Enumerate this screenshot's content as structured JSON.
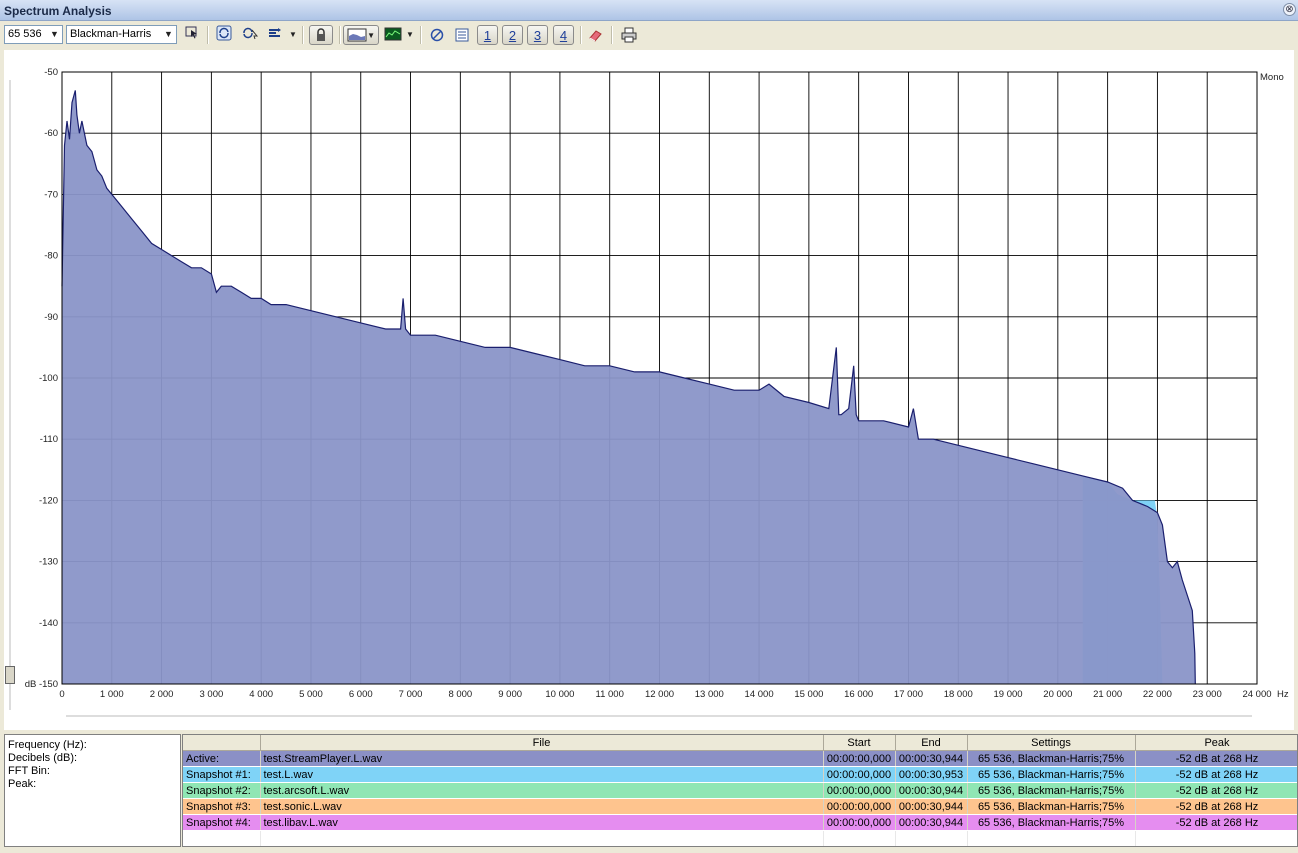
{
  "window": {
    "title": "Spectrum Analysis",
    "close_label": "⊗"
  },
  "toolbar": {
    "fft_size": "65 536",
    "window_function": "Blackman-Harris",
    "snapshot_buttons": [
      "1",
      "2",
      "3",
      "4"
    ]
  },
  "chart_data": {
    "type": "area",
    "channel_label": "Mono",
    "x_unit": "Hz",
    "y_unit": "dB",
    "xlim": [
      0,
      24000
    ],
    "ylim": [
      -150,
      -50
    ],
    "x_ticks": [
      0,
      1000,
      2000,
      3000,
      4000,
      5000,
      6000,
      7000,
      8000,
      9000,
      10000,
      11000,
      12000,
      13000,
      14000,
      15000,
      16000,
      17000,
      18000,
      19000,
      20000,
      21000,
      22000,
      23000,
      24000
    ],
    "x_tick_labels": [
      "0",
      "1 000",
      "2 000",
      "3 000",
      "4 000",
      "5 000",
      "6 000",
      "7 000",
      "8 000",
      "9 000",
      "10 000",
      "11 000",
      "12 000",
      "13 000",
      "14 000",
      "15 000",
      "16 000",
      "17 000",
      "18 000",
      "19 000",
      "20 000",
      "21 000",
      "22 000",
      "23 000",
      "24 000"
    ],
    "y_ticks": [
      -50,
      -60,
      -70,
      -80,
      -90,
      -100,
      -110,
      -120,
      -130,
      -140,
      -150
    ],
    "y_tick_labels": [
      "-50",
      "-60",
      "-70",
      "-80",
      "-90",
      "-100",
      "-110",
      "-120",
      "-130",
      "-140",
      "dB -150"
    ],
    "grid": true,
    "series": [
      {
        "name": "Active",
        "color": "#8a95c8",
        "stroke": "#1a1f6e",
        "x": [
          0,
          50,
          100,
          150,
          200,
          268,
          300,
          350,
          400,
          500,
          600,
          700,
          800,
          900,
          1000,
          1200,
          1400,
          1600,
          1800,
          2000,
          2200,
          2400,
          2600,
          2800,
          3000,
          3100,
          3200,
          3400,
          3600,
          3800,
          4000,
          4200,
          4500,
          5000,
          5500,
          6000,
          6500,
          6800,
          6850,
          6900,
          7000,
          7500,
          8000,
          8500,
          9000,
          9500,
          10000,
          10500,
          11000,
          11500,
          12000,
          12500,
          13000,
          13500,
          14000,
          14200,
          14500,
          15000,
          15400,
          15550,
          15600,
          15650,
          15800,
          15900,
          15950,
          16000,
          16500,
          17000,
          17100,
          17200,
          17500,
          18000,
          18500,
          19000,
          19500,
          20000,
          20500,
          21000,
          21300,
          21500,
          21800,
          22000,
          22100,
          22200,
          22300,
          22400,
          22500,
          22700,
          22750,
          22760
        ],
        "y": [
          -85,
          -62,
          -58,
          -61,
          -55,
          -53,
          -57,
          -60,
          -58,
          -62,
          -63,
          -66,
          -67,
          -69,
          -70,
          -72,
          -74,
          -76,
          -78,
          -79,
          -80,
          -81,
          -82,
          -82,
          -83,
          -86,
          -85,
          -85,
          -86,
          -87,
          -87,
          -88,
          -88,
          -89,
          -90,
          -91,
          -92,
          -92,
          -87,
          -92,
          -93,
          -93,
          -94,
          -95,
          -95,
          -96,
          -97,
          -98,
          -98,
          -99,
          -99,
          -100,
          -101,
          -102,
          -102,
          -101,
          -103,
          -104,
          -105,
          -95,
          -106,
          -106,
          -105,
          -98,
          -106,
          -107,
          -107,
          -108,
          -105,
          -110,
          -110,
          -111,
          -112,
          -113,
          -114,
          -115,
          -116,
          -117,
          -118,
          -120,
          -121,
          -122,
          -124,
          -130,
          -131,
          -130,
          -133,
          -138,
          -145,
          -150
        ]
      },
      {
        "name": "Snapshot #1",
        "color": "#78d0f5",
        "x": [
          20500,
          21000,
          21200,
          21500,
          21800,
          21950,
          22000,
          22050,
          22100
        ],
        "y": [
          -116,
          -117,
          -119,
          -120,
          -120,
          -120,
          -123,
          -135,
          -150
        ]
      }
    ]
  },
  "info_panel": {
    "lines": [
      "Frequency (Hz):",
      "Decibels (dB):",
      "FFT Bin:",
      "Peak:"
    ]
  },
  "snapshot_table": {
    "headers": [
      "",
      "File",
      "Start",
      "End",
      "Settings",
      "Peak"
    ],
    "rows": [
      {
        "label": "Active:",
        "file": "test.StreamPlayer.L.wav",
        "start": "00:00:00,000",
        "end": "00:00:30,944",
        "settings": "65 536, Blackman-Harris;75%",
        "peak": "-52 dB at 268 Hz",
        "color": "#8b90c6"
      },
      {
        "label": "Snapshot #1:",
        "file": "test.L.wav",
        "start": "00:00:00,000",
        "end": "00:00:30,953",
        "settings": "65 536, Blackman-Harris;75%",
        "peak": "-52 dB at 268 Hz",
        "color": "#7fd3f7"
      },
      {
        "label": "Snapshot #2:",
        "file": "test.arcsoft.L.wav",
        "start": "00:00:00,000",
        "end": "00:00:30,944",
        "settings": "65 536, Blackman-Harris;75%",
        "peak": "-52 dB at 268 Hz",
        "color": "#8fe6b4"
      },
      {
        "label": "Snapshot #3:",
        "file": "test.sonic.L.wav",
        "start": "00:00:00,000",
        "end": "00:00:30,944",
        "settings": "65 536, Blackman-Harris;75%",
        "peak": "-52 dB at 268 Hz",
        "color": "#fec48e"
      },
      {
        "label": "Snapshot #4:",
        "file": "test.libav.L.wav",
        "start": "00:00:00,000",
        "end": "00:00:30,944",
        "settings": "65 536, Blackman-Harris;75%",
        "peak": "-52 dB at 268 Hz",
        "color": "#e58df0"
      }
    ]
  }
}
